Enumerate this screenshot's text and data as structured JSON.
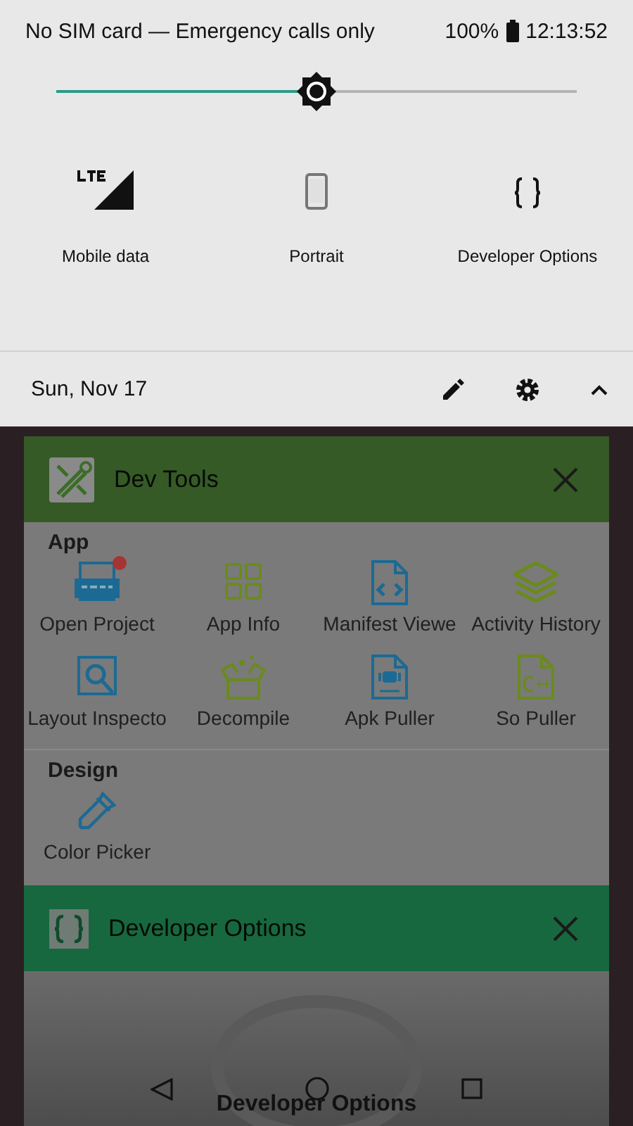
{
  "status_bar": {
    "carrier": "No SIM card — Emergency calls only",
    "battery": "100%",
    "time": "12:13:52"
  },
  "brightness": {
    "level": 0.5
  },
  "quick_tiles": [
    {
      "label": "Mobile data",
      "kind": "signal"
    },
    {
      "label": "Portrait",
      "kind": "phone"
    },
    {
      "label": "Developer Options",
      "kind": "braces"
    }
  ],
  "date": "Sun, Nov 17",
  "recents": [
    {
      "title": "Dev Tools",
      "kind": "tools",
      "color": "#365a26",
      "sections": [
        {
          "heading": "App",
          "items": [
            {
              "label": "Open Project",
              "kind": "code",
              "badge": true
            },
            {
              "label": "App Info",
              "kind": "grid",
              "badge": false
            },
            {
              "label": "Manifest Viewe",
              "kind": "manifest",
              "badge": false
            },
            {
              "label": "Activity History",
              "kind": "layers",
              "badge": false
            },
            {
              "label": "Layout Inspecto",
              "kind": "inspect",
              "badge": false
            },
            {
              "label": "Decompile",
              "kind": "box",
              "badge": false
            },
            {
              "label": "Apk Puller",
              "kind": "apk",
              "badge": false
            },
            {
              "label": "So Puller",
              "kind": "cpp",
              "badge": false
            }
          ]
        },
        {
          "heading": "Design",
          "items": [
            {
              "label": "Color Picker",
              "kind": "picker",
              "badge": false
            }
          ]
        }
      ]
    },
    {
      "title": "Developer Options",
      "kind": "braces",
      "color": "#17683e",
      "body_label": "Developer Options"
    }
  ]
}
